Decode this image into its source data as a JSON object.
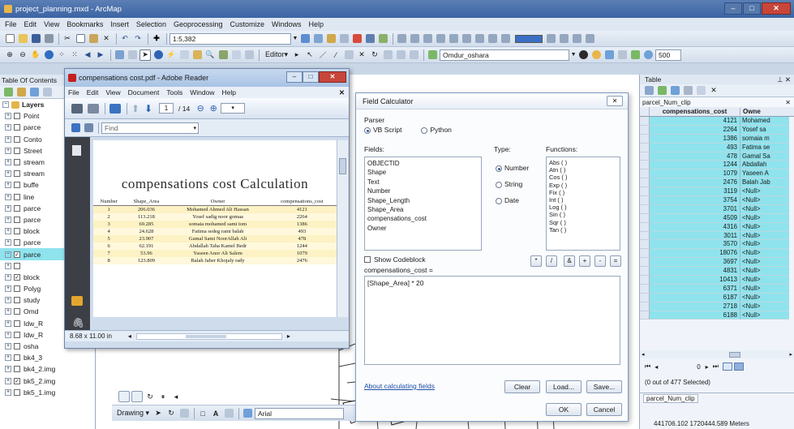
{
  "app": {
    "title": "project_planning.mxd - ArcMap"
  },
  "menu": [
    "File",
    "Edit",
    "View",
    "Bookmarks",
    "Insert",
    "Selection",
    "Geoprocessing",
    "Customize",
    "Windows",
    "Help"
  ],
  "toolbar": {
    "scale": "1:5,382",
    "editor_label": "Editor▾",
    "layer_select": "Omdur_oshara",
    "zoom_value": "500"
  },
  "toc": {
    "title": "Table Of Contents",
    "layers_label": "Layers",
    "items": [
      {
        "label": "Point",
        "checked": false
      },
      {
        "label": "parce",
        "checked": false
      },
      {
        "label": "Conto",
        "checked": false
      },
      {
        "label": "Street",
        "checked": false
      },
      {
        "label": "stream",
        "checked": false
      },
      {
        "label": "stream",
        "checked": false
      },
      {
        "label": "buffe",
        "checked": false
      },
      {
        "label": "line",
        "checked": false
      },
      {
        "label": "parce",
        "checked": false
      },
      {
        "label": "parce",
        "checked": false
      },
      {
        "label": "block",
        "checked": false
      },
      {
        "label": "parce",
        "checked": false
      },
      {
        "label": "parce",
        "checked": true
      },
      {
        "label": "",
        "checked": false
      },
      {
        "label": "block",
        "checked": true
      },
      {
        "label": "Polyg",
        "checked": false
      },
      {
        "label": "study",
        "checked": false
      },
      {
        "label": "Omd",
        "checked": false
      },
      {
        "label": "Idw_R",
        "checked": false
      },
      {
        "label": "Idw_R",
        "checked": false
      },
      {
        "label": "osha",
        "checked": false
      },
      {
        "label": "bk4_3",
        "checked": false
      },
      {
        "label": "bk4_2.img",
        "checked": false
      },
      {
        "label": "bk5_2.img",
        "checked": true
      },
      {
        "label": "bk5_1.img",
        "checked": false
      }
    ]
  },
  "pdf": {
    "title": "compensations cost.pdf - Adobe Reader",
    "menu": [
      "File",
      "Edit",
      "View",
      "Document",
      "Tools",
      "Window",
      "Help"
    ],
    "page_current": "1",
    "page_total": "/ 14",
    "find_placeholder": "Find",
    "page_size": "8.68 x 11.00 in",
    "doc_title": "compensations cost Calculation",
    "columns": [
      "Number",
      "Shape_Area",
      "Owner",
      "compensations_cost"
    ],
    "rows": [
      [
        "1",
        "206.036",
        "Mohamed Ahmed Ali Hassan",
        "4121"
      ],
      [
        "2",
        "113.218",
        "Yosef sadig noor gomaa",
        "2264"
      ],
      [
        "3",
        "69.285",
        "somaia mohamed sami tom",
        "1386"
      ],
      [
        "4",
        "24.628",
        "Fatima sedeg rami balah",
        "493"
      ],
      [
        "5",
        "23.907",
        "Gamal Sami NoorAllah Ali",
        "478"
      ],
      [
        "6",
        "62.191",
        "Abdallah Taha Kamel Bedr",
        "1244"
      ],
      [
        "7",
        "53.96",
        "Yaseen Anor Ali Salem",
        "1079"
      ],
      [
        "8",
        "123.809",
        "Balah Jaber Khojaly rady",
        "2476"
      ]
    ]
  },
  "field_calc": {
    "title": "Field Calculator",
    "parser_label": "Parser",
    "vbscript": "VB Script",
    "python": "Python",
    "fields_label": "Fields:",
    "fields": [
      "OBJECTID",
      "Shape",
      "Text",
      "Number",
      "Shape_Length",
      "Shape_Area",
      "compensations_cost",
      "Owner"
    ],
    "type_label": "Type:",
    "types": [
      "Number",
      "String",
      "Date"
    ],
    "functions_label": "Functions:",
    "functions": [
      "Abs ( )",
      "Atn ( )",
      "Cos ( )",
      "Exp ( )",
      "Fix ( )",
      "Int ( )",
      "Log ( )",
      "Sin ( )",
      "Sqr ( )",
      "Tan ( )"
    ],
    "show_codeblock": "Show Codeblock",
    "operators": [
      "*",
      "/",
      "&",
      "+",
      "-",
      "="
    ],
    "expr_label": "compensations_cost =",
    "expression": "[Shape_Area] * 20",
    "about_link": "About calculating fields",
    "clear": "Clear",
    "load": "Load...",
    "save": "Save...",
    "ok": "OK",
    "cancel": "Cancel"
  },
  "table": {
    "title": "Table",
    "tab_name": "parcel_Num_clip",
    "col_cost": "compensations_cost",
    "col_owner": "Owne",
    "rows": [
      [
        "4121",
        "Mohamed"
      ],
      [
        "2264",
        "Yosef sa"
      ],
      [
        "1386",
        "somaia m"
      ],
      [
        "493",
        "Fatima se"
      ],
      [
        "478",
        "Gamal Sa"
      ],
      [
        "1244",
        "Abdallah"
      ],
      [
        "1079",
        "Yaseen A"
      ],
      [
        "2476",
        "Balah Jab"
      ],
      [
        "3119",
        "<Null>"
      ],
      [
        "3754",
        "<Null>"
      ],
      [
        "3701",
        "<Null>"
      ],
      [
        "4509",
        "<Null>"
      ],
      [
        "4316",
        "<Null>"
      ],
      [
        "3011",
        "<Null>"
      ],
      [
        "3570",
        "<Null>"
      ],
      [
        "18076",
        "<Null>"
      ],
      [
        "3697",
        "<Null>"
      ],
      [
        "4831",
        "<Null>"
      ],
      [
        "10413",
        "<Null>"
      ],
      [
        "6371",
        "<Null>"
      ],
      [
        "6187",
        "<Null>"
      ],
      [
        "2718",
        "<Null>"
      ],
      [
        "6188",
        "<Null>"
      ]
    ],
    "record": "0",
    "selected": "(0 out of 477 Selected)",
    "bottom_tab": "parcel_Num_clip"
  },
  "drawing": {
    "label": "Drawing ▾",
    "font": "Arial"
  },
  "status": {
    "coords": "441706.102  1720444.589 Meters"
  }
}
